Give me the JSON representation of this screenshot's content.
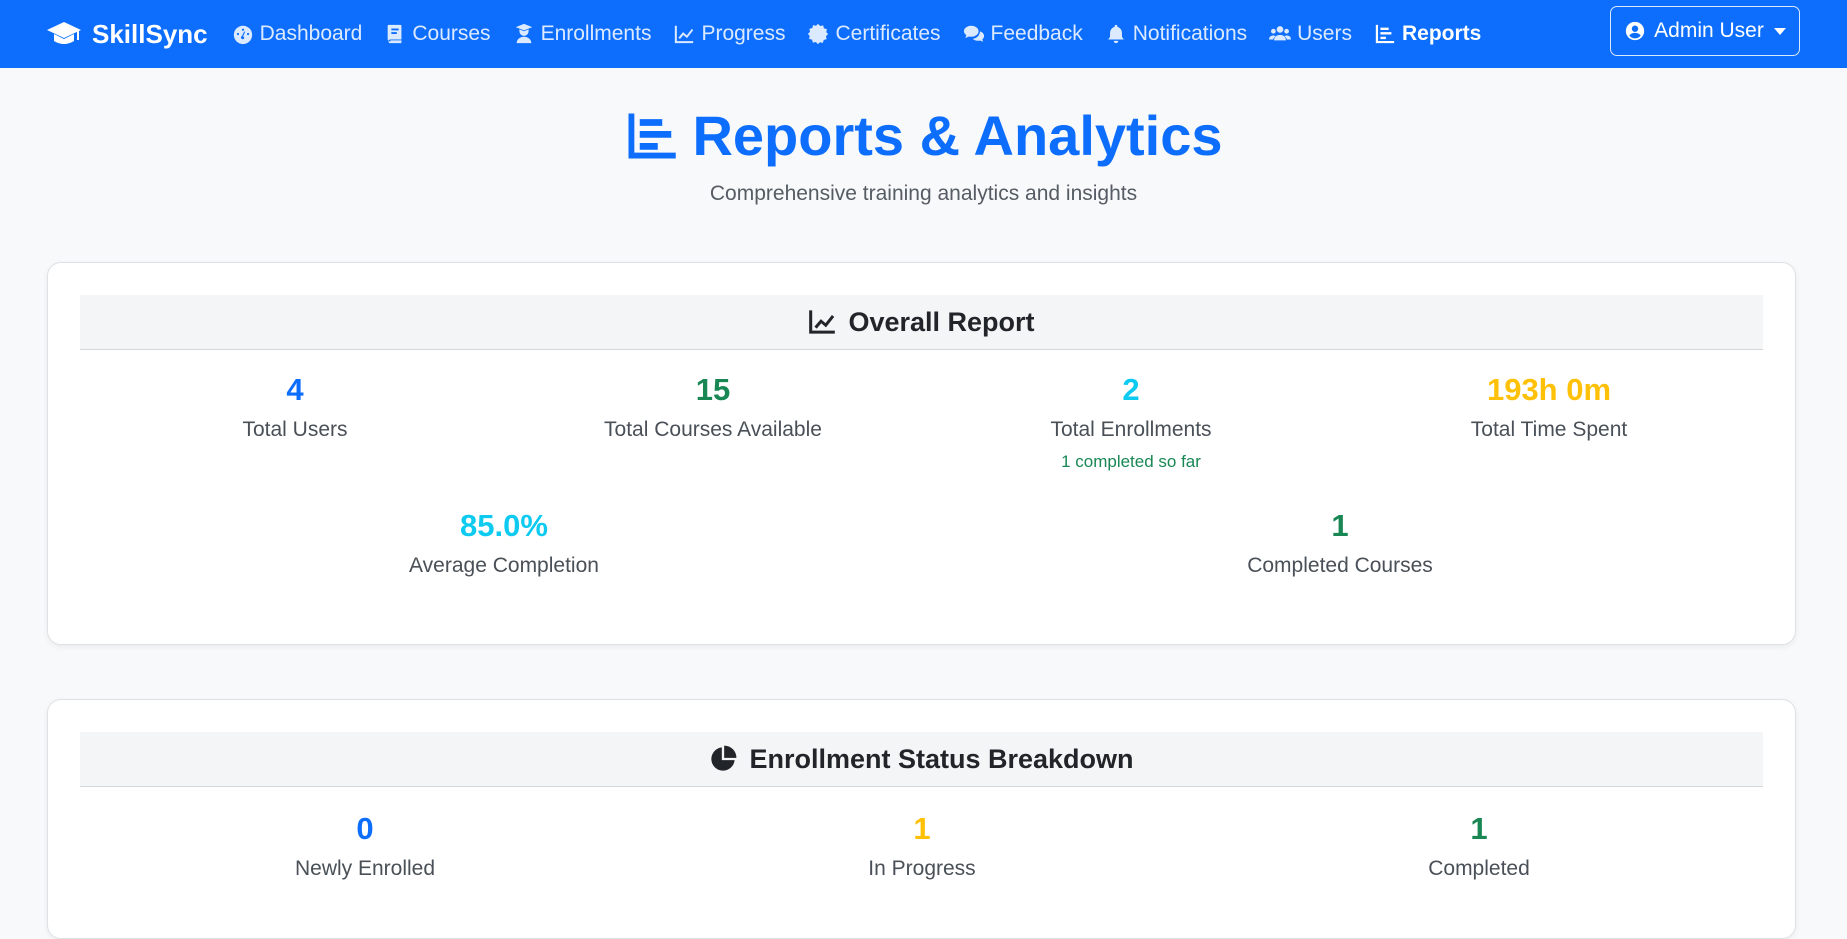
{
  "brand": {
    "name": "SkillSync",
    "icon": "graduation-cap-icon"
  },
  "nav": [
    {
      "label": "Dashboard",
      "icon": "gauge-icon",
      "active": false
    },
    {
      "label": "Courses",
      "icon": "book-icon",
      "active": false
    },
    {
      "label": "Enrollments",
      "icon": "user-graduate-icon",
      "active": false
    },
    {
      "label": "Progress",
      "icon": "line-chart-icon",
      "active": false
    },
    {
      "label": "Certificates",
      "icon": "certificate-icon",
      "active": false
    },
    {
      "label": "Feedback",
      "icon": "comments-icon",
      "active": false
    },
    {
      "label": "Notifications",
      "icon": "bell-icon",
      "active": false
    },
    {
      "label": "Users",
      "icon": "users-icon",
      "active": false
    },
    {
      "label": "Reports",
      "icon": "bar-chart-icon",
      "active": true
    }
  ],
  "user_menu": {
    "label": "Admin User",
    "icon": "user-circle-icon"
  },
  "page": {
    "title": "Reports & Analytics",
    "subtitle": "Comprehensive training analytics and insights"
  },
  "overall_report": {
    "title": "Overall Report",
    "icon": "line-chart-icon",
    "stats": [
      {
        "value": "4",
        "label": "Total Users",
        "color": "#0d6efd"
      },
      {
        "value": "15",
        "label": "Total Courses Available",
        "color": "#198754"
      },
      {
        "value": "2",
        "label": "Total Enrollments",
        "color": "#0dcaf0",
        "note": "1 completed so far"
      },
      {
        "value": "193h 0m",
        "label": "Total Time Spent",
        "color": "#ffc107"
      },
      {
        "value": "85.0%",
        "label": "Average Completion",
        "color": "#0dcaf0"
      },
      {
        "value": "1",
        "label": "Completed Courses",
        "color": "#198754"
      }
    ]
  },
  "enrollment_breakdown": {
    "title": "Enrollment Status Breakdown",
    "icon": "pie-chart-icon",
    "stats": [
      {
        "value": "0",
        "label": "Newly Enrolled",
        "color": "#0d6efd"
      },
      {
        "value": "1",
        "label": "In Progress",
        "color": "#ffc107"
      },
      {
        "value": "1",
        "label": "Completed",
        "color": "#198754"
      }
    ]
  }
}
